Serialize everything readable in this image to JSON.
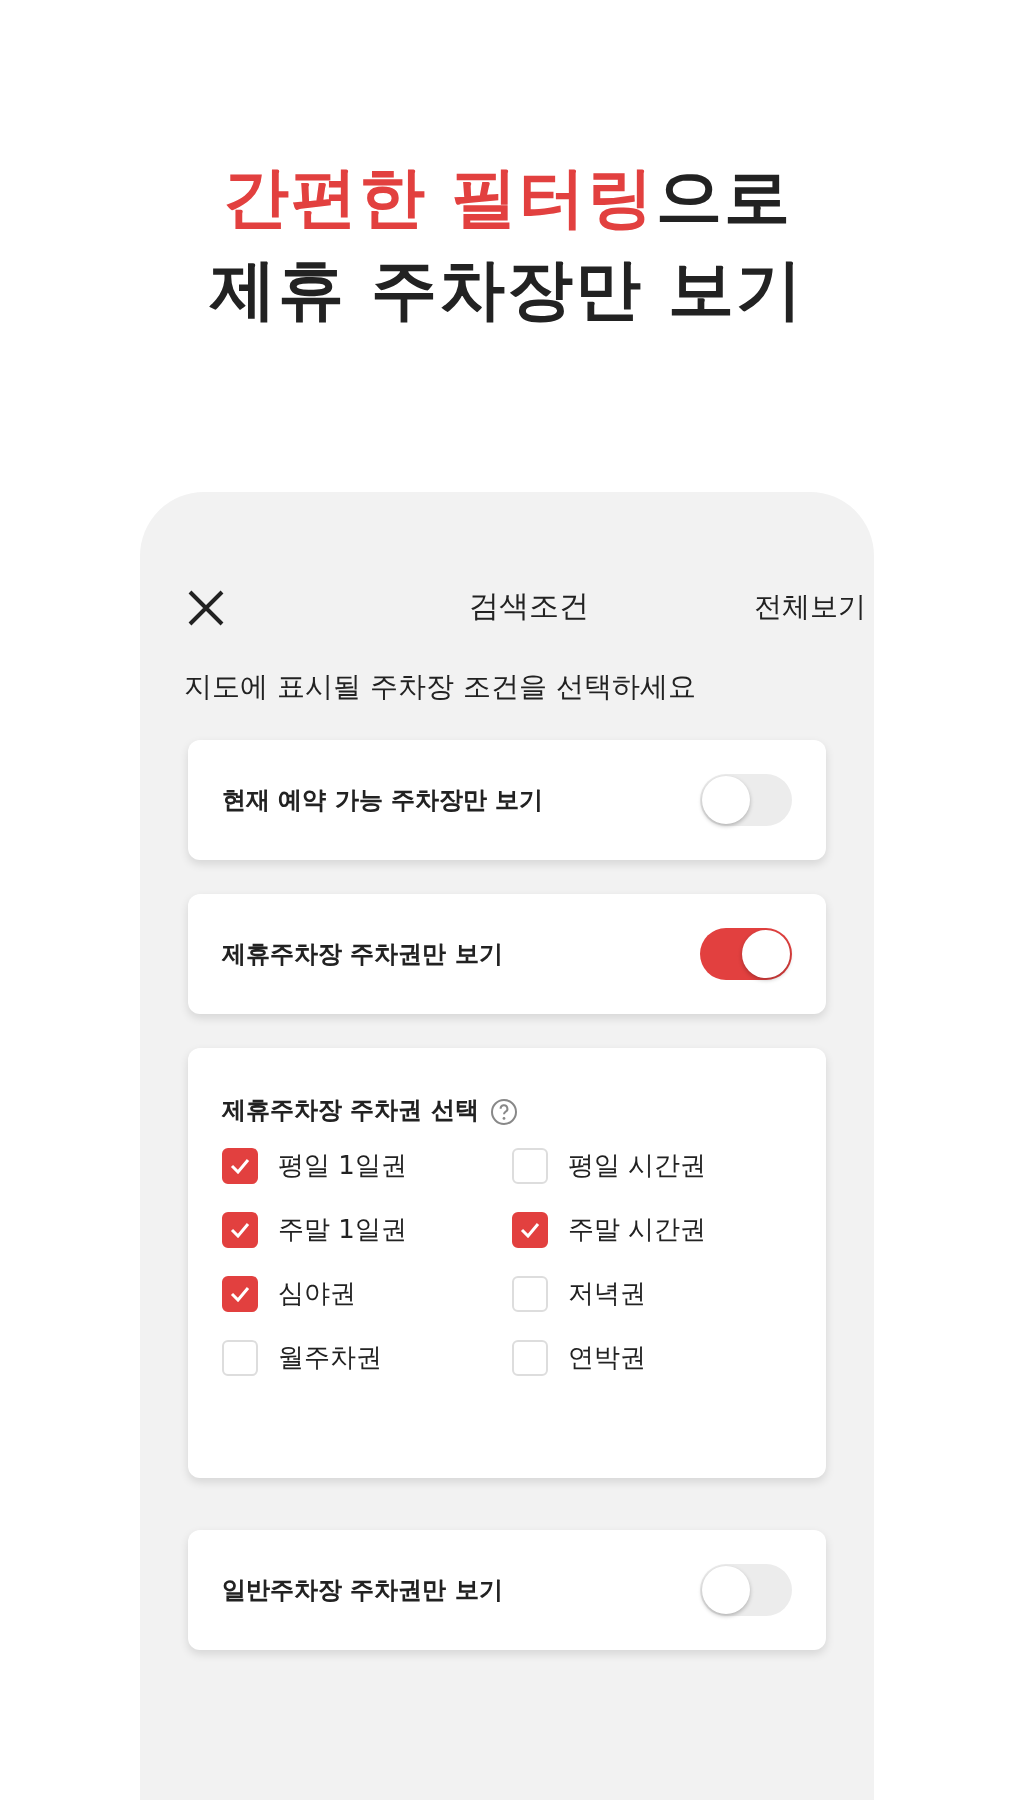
{
  "headline": {
    "accent": "간편한 필터링",
    "rest": "으로",
    "line2": "제휴 주차장만 보기"
  },
  "screen": {
    "title": "검색조건",
    "action": "전체보기",
    "subtitle": "지도에 표시될 주차장 조건을 선택하세요"
  },
  "cards": [
    {
      "kind": "toggle",
      "label": "현재 예약 가능 주차장만 보기",
      "on": false
    },
    {
      "kind": "toggle",
      "label": "제휴주차장 주차권만 보기",
      "on": true
    },
    {
      "kind": "checkboxes",
      "label": "제휴주차장 주차권 선택",
      "options": [
        {
          "label": "평일 1일권",
          "checked": true
        },
        {
          "label": "평일 시간권",
          "checked": false
        },
        {
          "label": "주말 1일권",
          "checked": true
        },
        {
          "label": "주말 시간권",
          "checked": true
        },
        {
          "label": "심야권",
          "checked": true
        },
        {
          "label": "저녁권",
          "checked": false
        },
        {
          "label": "월주차권",
          "checked": false
        },
        {
          "label": "연박권",
          "checked": false
        }
      ]
    },
    {
      "kind": "toggle",
      "label": "일반주차장 주차권만 보기",
      "on": false
    }
  ]
}
